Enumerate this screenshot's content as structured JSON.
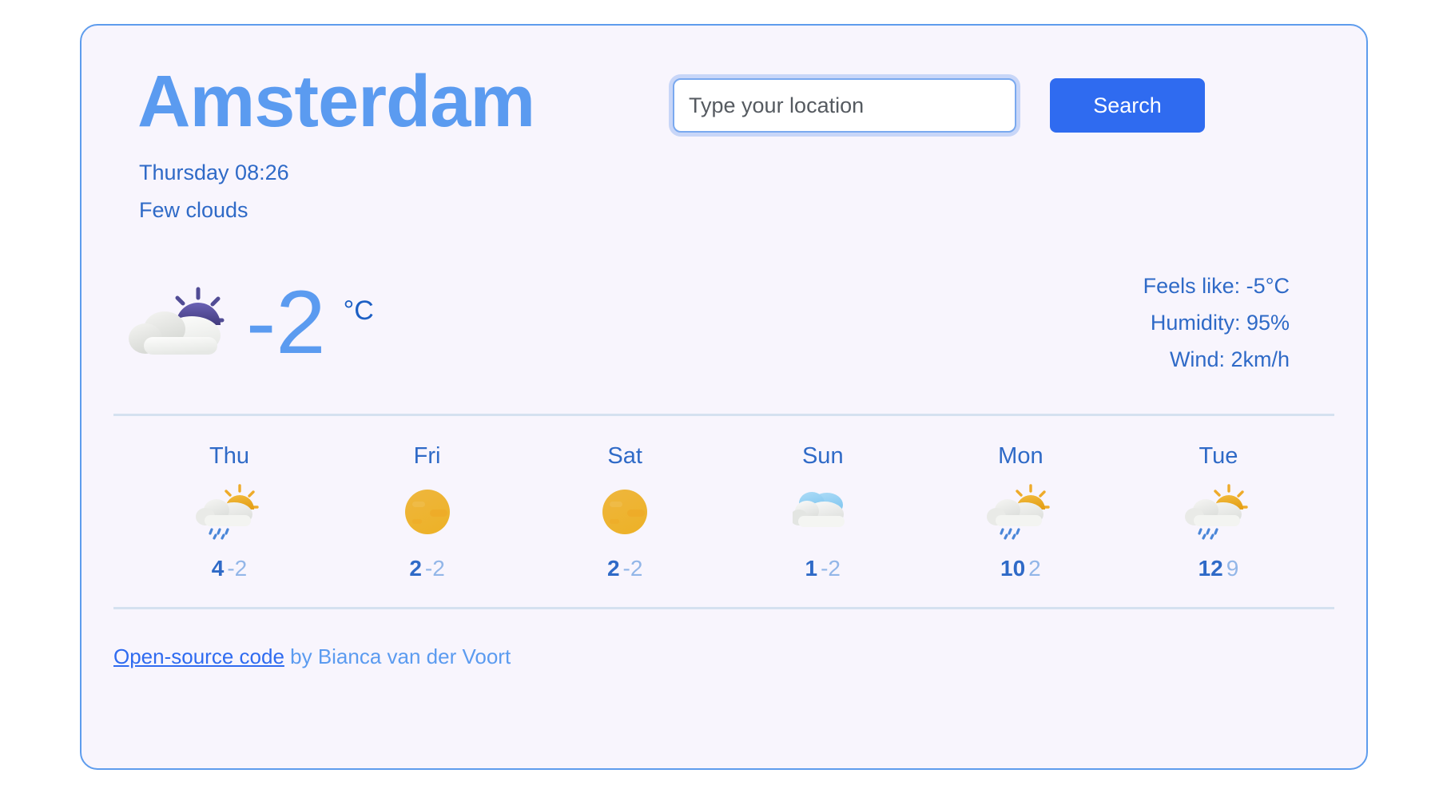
{
  "card": {
    "city": "Amsterdam",
    "datetime": "Thursday 08:26",
    "condition": "Few clouds"
  },
  "search": {
    "placeholder": "Type your location",
    "value": "",
    "button_label": "Search"
  },
  "current": {
    "icon": "few-clouds-night-icon",
    "temperature": "-2",
    "unit": "°C",
    "feels_like": "Feels like: -5°C",
    "humidity": "Humidity: 95%",
    "wind": "Wind: 2km/h"
  },
  "forecast": [
    {
      "day": "Thu",
      "icon": "sun-cloud-rain-icon",
      "max": "4",
      "min": "-2"
    },
    {
      "day": "Fri",
      "icon": "sun-icon",
      "max": "2",
      "min": "-2"
    },
    {
      "day": "Sat",
      "icon": "sun-icon",
      "max": "2",
      "min": "-2"
    },
    {
      "day": "Sun",
      "icon": "cloud-icon",
      "max": "1",
      "min": "-2"
    },
    {
      "day": "Mon",
      "icon": "sun-cloud-rain-icon",
      "max": "10",
      "min": "2"
    },
    {
      "day": "Tue",
      "icon": "sun-cloud-rain-icon",
      "max": "12",
      "min": "9"
    }
  ],
  "footer": {
    "link_text": "Open-source code",
    "credit": " by Bianca van der Voort"
  },
  "colors": {
    "accent": "#2f6bf0",
    "title": "#5b9bf0",
    "text": "#2f6ac7",
    "muted": "#92b6e8",
    "card_bg": "#f8f5fd",
    "card_border": "#5e9ced",
    "sun": "#eeab2a",
    "night_sun": "#504b96"
  }
}
